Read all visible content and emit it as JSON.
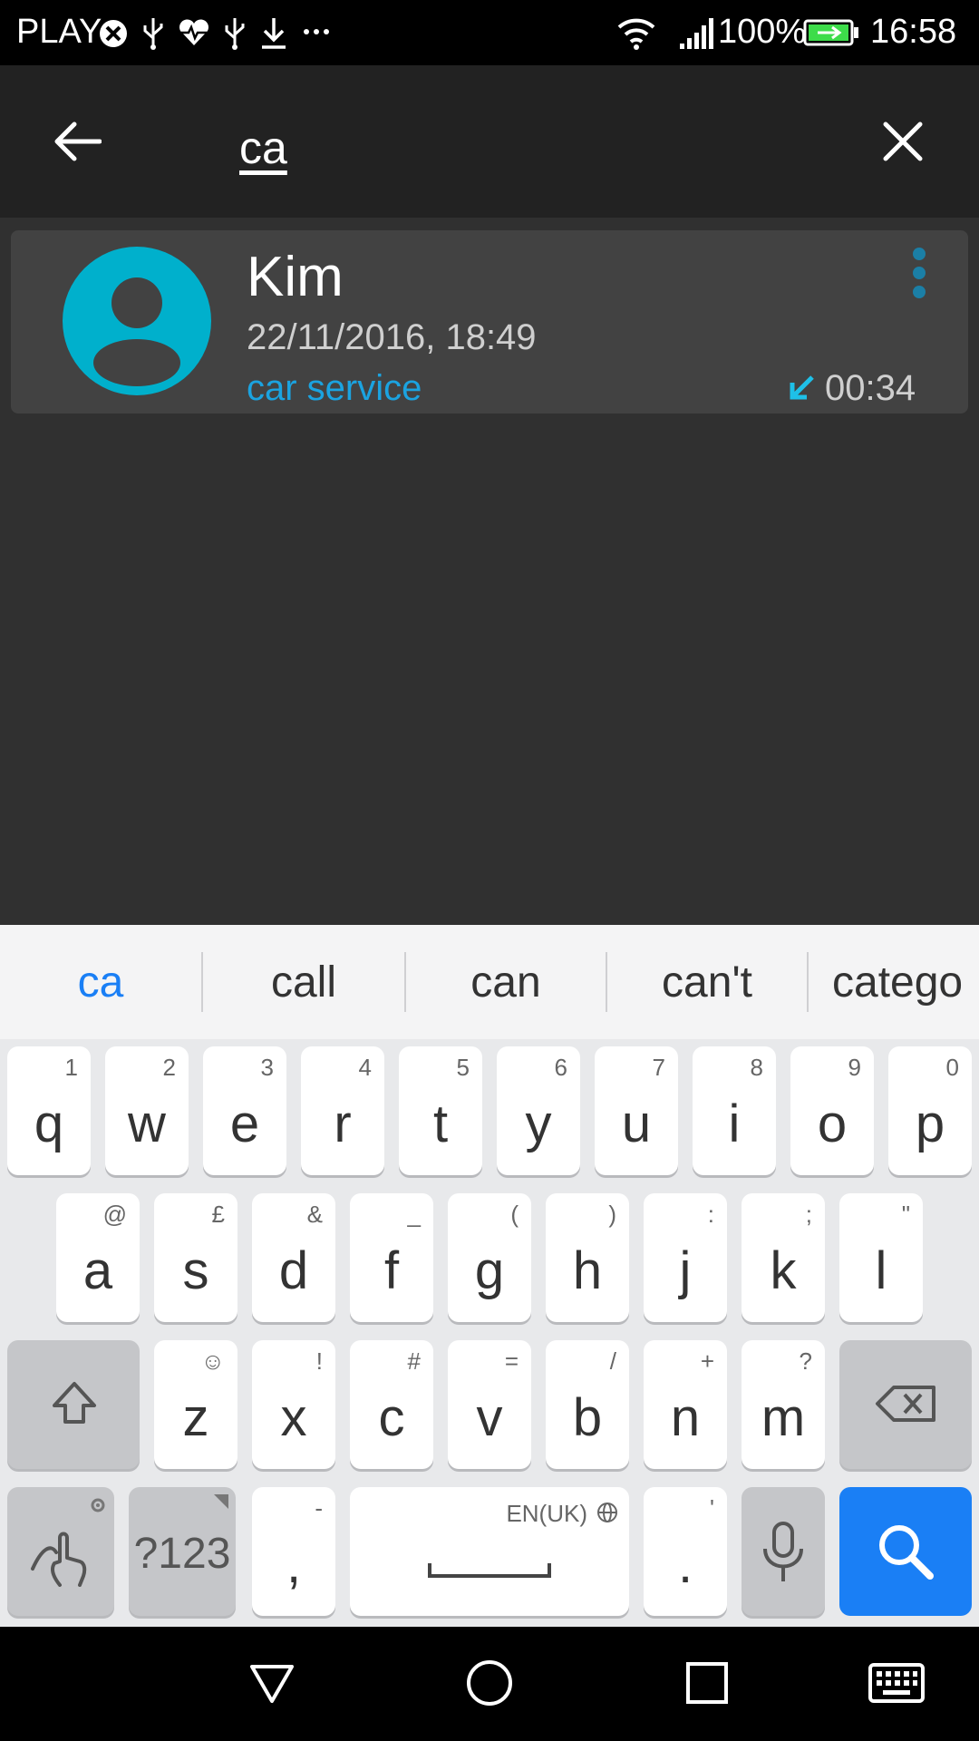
{
  "status_bar": {
    "carrier": "PLAY",
    "battery_percent": "100%",
    "time": "16:58",
    "icons": [
      "blocked-circle-icon",
      "usb-icon",
      "health-heart-icon",
      "usb-icon",
      "download-icon",
      "more-dots-icon",
      "wifi-icon",
      "signal-icon",
      "battery-charging-icon"
    ]
  },
  "search": {
    "query": "ca",
    "back_icon": "arrow-left-icon",
    "clear_icon": "close-icon"
  },
  "results": [
    {
      "name": "Kim",
      "date": "22/11/2016, 18:49",
      "label": "car service",
      "duration": "00:34",
      "call_type_icon": "incoming-call-arrow-icon",
      "avatar_icon": "contact-avatar-icon",
      "menu_icon": "more-vertical-icon"
    }
  ],
  "keyboard": {
    "suggestions": [
      "ca",
      "call",
      "can",
      "can't",
      "catego"
    ],
    "row1": [
      {
        "key": "q",
        "sub": "1"
      },
      {
        "key": "w",
        "sub": "2"
      },
      {
        "key": "e",
        "sub": "3"
      },
      {
        "key": "r",
        "sub": "4"
      },
      {
        "key": "t",
        "sub": "5"
      },
      {
        "key": "y",
        "sub": "6"
      },
      {
        "key": "u",
        "sub": "7"
      },
      {
        "key": "i",
        "sub": "8"
      },
      {
        "key": "o",
        "sub": "9"
      },
      {
        "key": "p",
        "sub": "0"
      }
    ],
    "row2": [
      {
        "key": "a",
        "sub": "@"
      },
      {
        "key": "s",
        "sub": "£"
      },
      {
        "key": "d",
        "sub": "&"
      },
      {
        "key": "f",
        "sub": "_"
      },
      {
        "key": "g",
        "sub": "("
      },
      {
        "key": "h",
        "sub": ")"
      },
      {
        "key": "j",
        "sub": ":"
      },
      {
        "key": "k",
        "sub": ";"
      },
      {
        "key": "l",
        "sub": "\""
      }
    ],
    "row3": [
      {
        "key": "z",
        "sub": "☺"
      },
      {
        "key": "x",
        "sub": "!"
      },
      {
        "key": "c",
        "sub": "#"
      },
      {
        "key": "v",
        "sub": "="
      },
      {
        "key": "b",
        "sub": "/"
      },
      {
        "key": "n",
        "sub": "+"
      },
      {
        "key": "m",
        "sub": "?"
      }
    ],
    "symbols_label": "?123",
    "comma": ",",
    "comma_sub": "-",
    "period": ".",
    "period_sub": "'",
    "space_language": "EN(UK)",
    "accent_color": "#1a7ff5"
  },
  "nav_bar": {
    "icons": [
      "back-triangle-icon",
      "home-circle-icon",
      "recents-square-icon",
      "keyboard-icon"
    ]
  }
}
